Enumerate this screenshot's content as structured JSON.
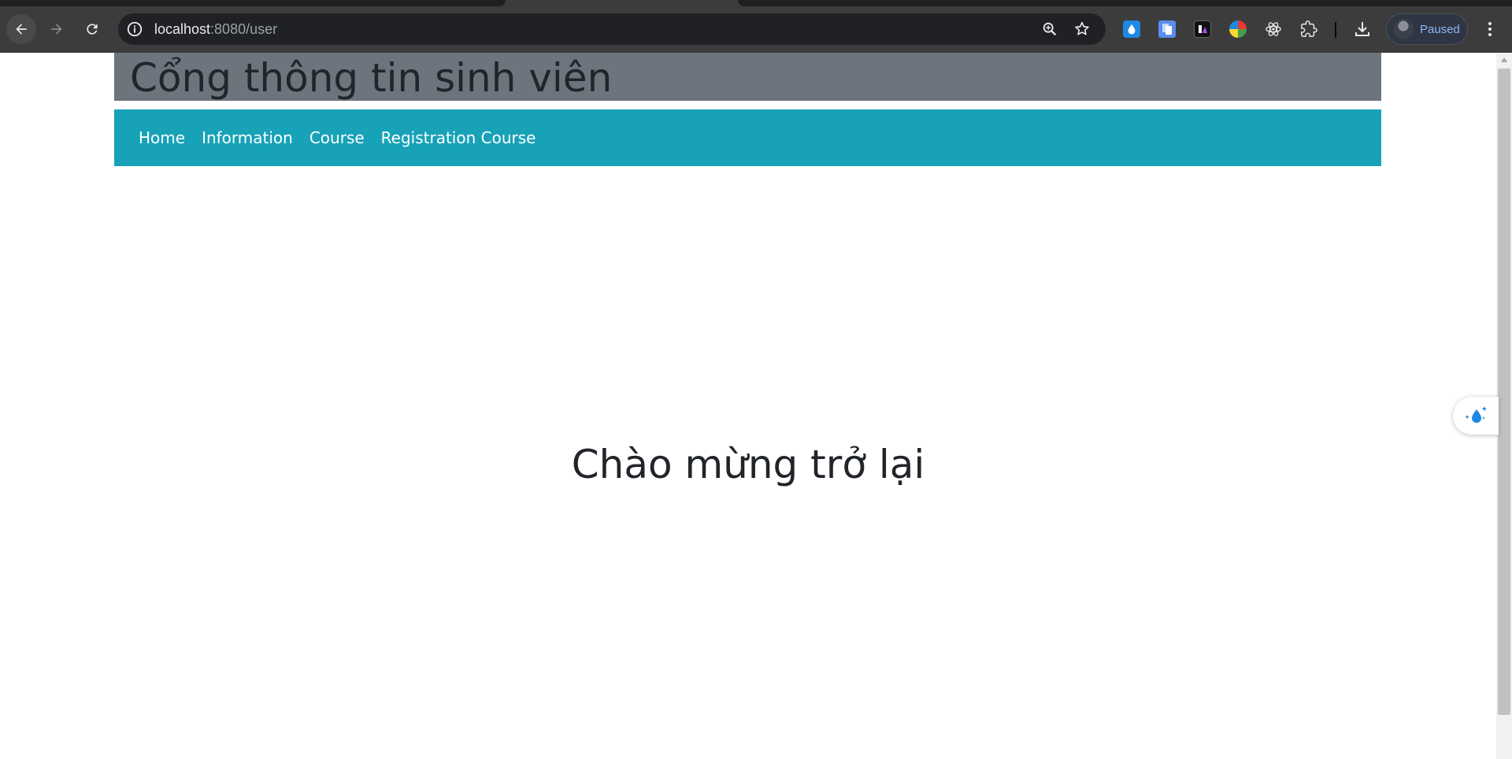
{
  "browser": {
    "url_host": "localhost",
    "url_path": ":8080/user",
    "profile_status": "Paused"
  },
  "page": {
    "site_title": "Cổng thông tin sinh viên",
    "nav": [
      "Home",
      "Information",
      "Course",
      "Registration Course"
    ],
    "welcome": "Chào mừng trở lại"
  },
  "colors": {
    "header_bg": "#6c757d",
    "navbar_bg": "#17a2b8"
  }
}
